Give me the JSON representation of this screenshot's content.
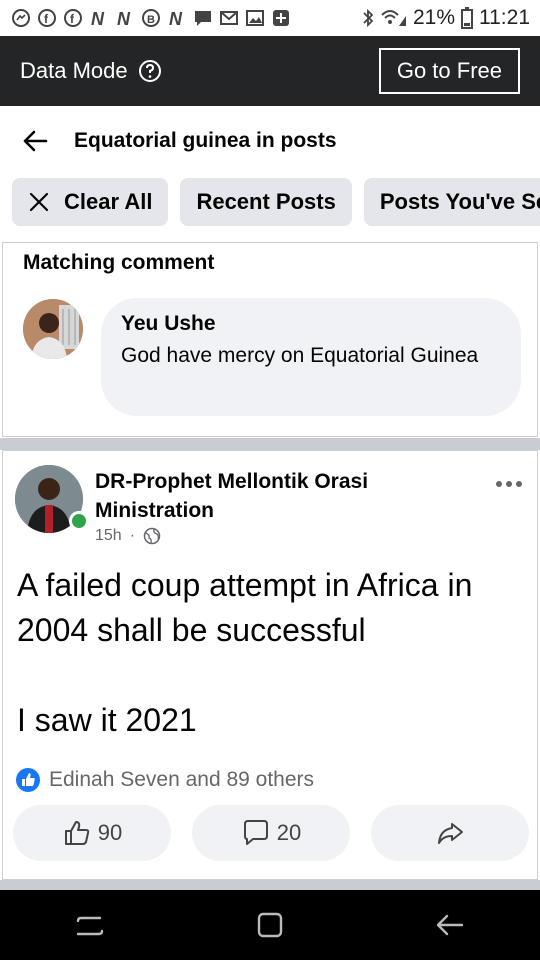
{
  "status_bar": {
    "battery": "21%",
    "time": "11:21",
    "notification_icons": [
      "messenger-icon",
      "facebook-icon",
      "facebook-icon",
      "n-icon",
      "n-icon",
      "b-icon",
      "n-icon",
      "chat-icon",
      "gmail-icon",
      "image-icon",
      "plus-square-icon"
    ]
  },
  "data_bar": {
    "title": "Data Mode",
    "free_button": "Go to Free"
  },
  "header": {
    "title": "Equatorial guinea in posts"
  },
  "chips": {
    "clear_all": "Clear All",
    "recent_posts": "Recent Posts",
    "posts_seen": "Posts You've Se"
  },
  "matching_card": {
    "heading": "Matching comment",
    "commenter": "Yeu Ushe",
    "comment": "God have mercy on Equatorial Guinea"
  },
  "post": {
    "author": "DR-Prophet Mellontik Orasi Ministration",
    "time": "15h",
    "separator": "·",
    "text": "A failed coup attempt in Africa in 2004 shall be successful\n\nI saw  it 2021",
    "reactions_text": "Edinah Seven and 89 others",
    "like_count": "90",
    "comment_count": "20"
  },
  "colors": {
    "data_bar_bg": "#242526",
    "chip_bg": "#e4e6eb",
    "like_blue": "#1877f2",
    "online_green": "#31a24c"
  }
}
